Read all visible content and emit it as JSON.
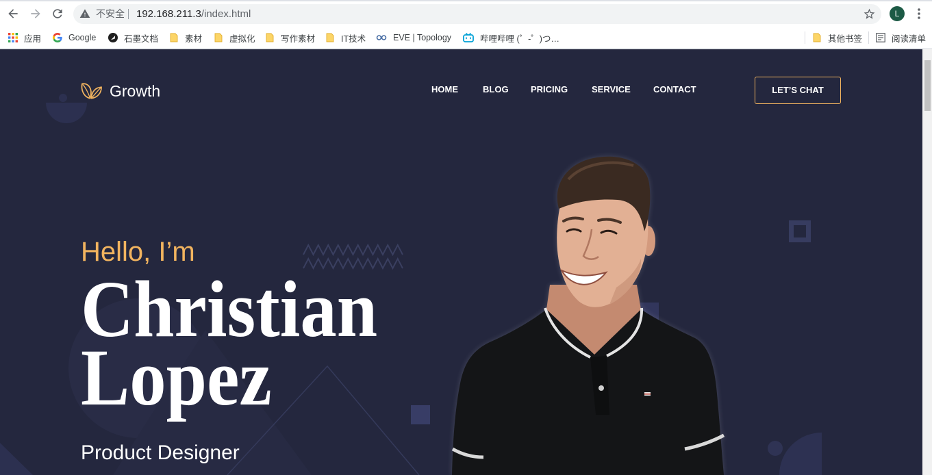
{
  "browser": {
    "toolbar": {
      "back_icon": "arrow-left-icon",
      "forward_icon": "arrow-right-icon",
      "reload_icon": "reload-icon",
      "security_icon": "warning-icon",
      "security_label": "不安全",
      "url_host": "192.168.211.3",
      "url_path": "/index.html",
      "bookmark_star_icon": "star-icon",
      "profile_initial": "L",
      "menu_icon": "more-vertical-icon"
    },
    "bookmarks": [
      {
        "label": "应用",
        "icon": "apps-grid-icon"
      },
      {
        "label": "Google",
        "icon": "google-icon"
      },
      {
        "label": "石墨文档",
        "icon": "shimo-icon"
      },
      {
        "label": "素材",
        "icon": "folder-icon"
      },
      {
        "label": "虚拟化",
        "icon": "folder-icon"
      },
      {
        "label": "写作素材",
        "icon": "folder-icon"
      },
      {
        "label": "IT技术",
        "icon": "folder-icon"
      },
      {
        "label": "EVE | Topology",
        "icon": "eve-topology-icon"
      },
      {
        "label": "哔哩哔哩 (゜-゜)つ…",
        "icon": "bilibili-icon"
      }
    ],
    "other_bookmarks": {
      "label": "其他书签",
      "icon": "folder-icon"
    },
    "reading_list": {
      "label": "阅读清单",
      "icon": "reading-list-icon"
    }
  },
  "site": {
    "logo": {
      "text": "Growth",
      "icon": "leaf-icon"
    },
    "nav": [
      {
        "label": "HOME"
      },
      {
        "label": "BLOG"
      },
      {
        "label": "PRICING"
      },
      {
        "label": "SERVICE"
      },
      {
        "label": "CONTACT"
      }
    ],
    "cta_label": "LET’S CHAT",
    "hero": {
      "greeting": "Hello, I’m",
      "name_line1": "Christian",
      "name_line2": "Lopez",
      "role": "Product Designer"
    }
  },
  "colors": {
    "page_bg": "#24273e",
    "accent": "#f2b45f",
    "text": "#ffffff",
    "profile_bg": "#1c5a45"
  }
}
